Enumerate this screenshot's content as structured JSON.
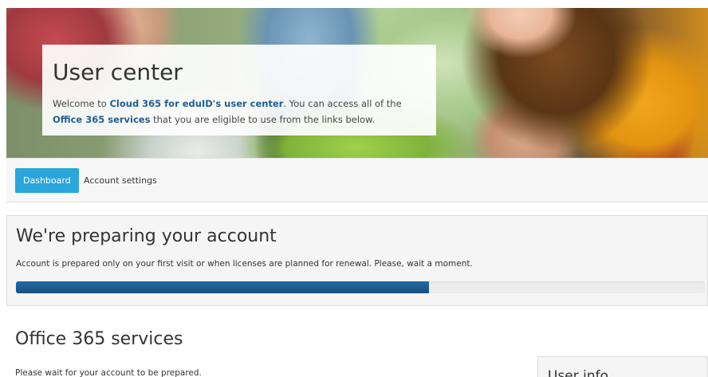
{
  "hero": {
    "title": "User center",
    "text_1": "Welcome to ",
    "brand": "Cloud 365 for eduID's user center",
    "text_2": ". You can access all of the ",
    "services_link": "Office 365 services",
    "text_3": " that you are eligible to use from the links below."
  },
  "nav": {
    "tabs": [
      {
        "label": "Dashboard",
        "active": true
      },
      {
        "label": "Account settings",
        "active": false
      }
    ]
  },
  "preparing": {
    "title": "We're preparing your account",
    "text": "Account is prepared only on your first visit or when licenses are planned for renewal. Please, wait a moment.",
    "progress_percent": 60
  },
  "services": {
    "title": "Office 365 services",
    "text": "Please wait for your account to be prepared."
  },
  "user_info": {
    "title": "User info"
  },
  "colors": {
    "accent": "#2aa6db",
    "progress": "#1c5a8c",
    "link": "#1f5e95"
  }
}
